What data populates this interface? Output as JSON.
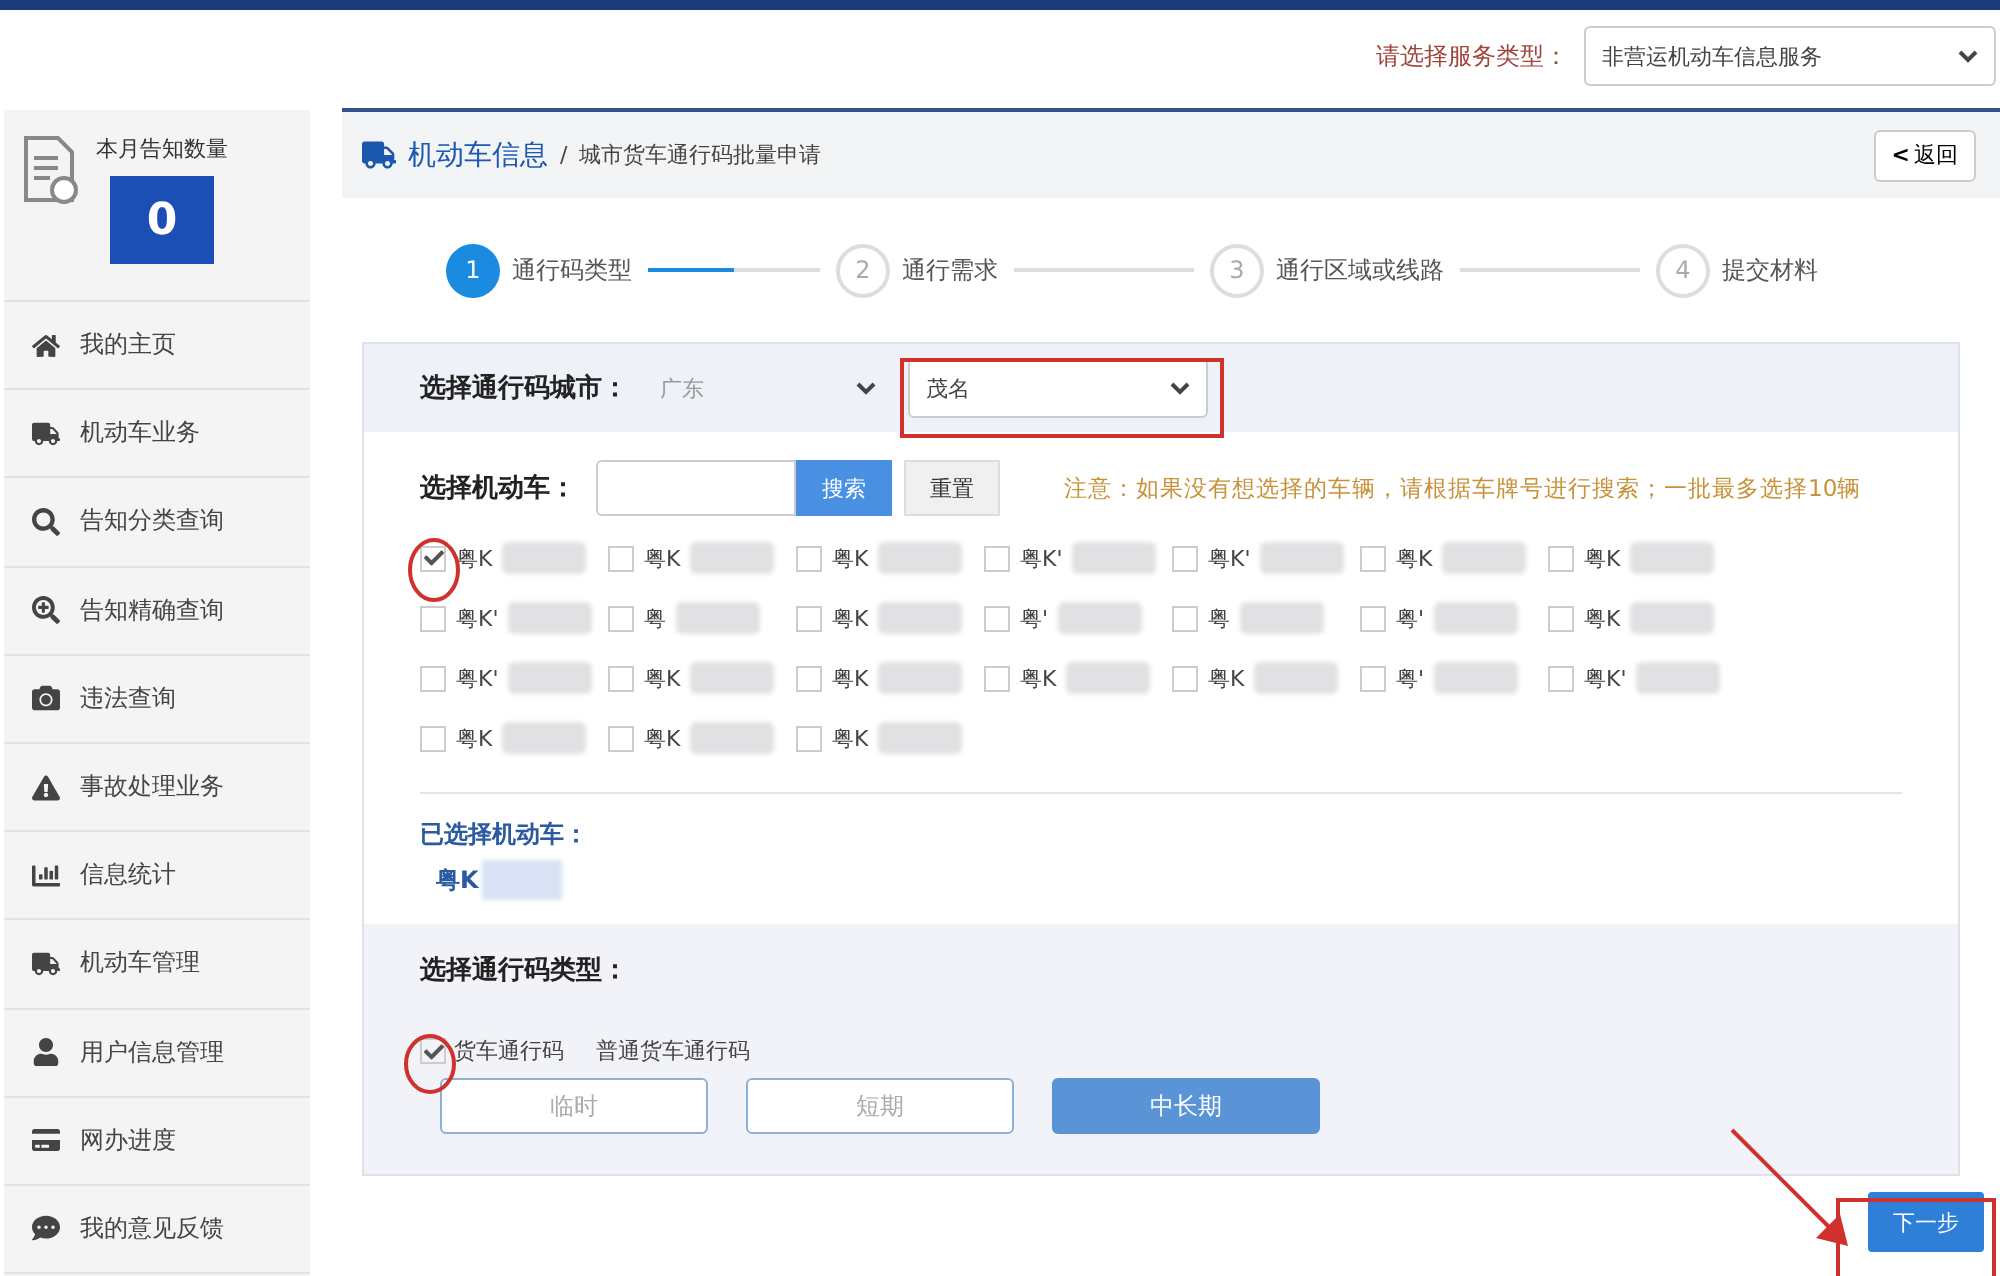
{
  "service": {
    "label": "请选择服务类型：",
    "value": "非营运机动车信息服务"
  },
  "sidebar": {
    "notice": {
      "label": "本月告知数量",
      "count": "0"
    },
    "items": [
      {
        "label": "我的主页",
        "kind": "home"
      },
      {
        "label": "机动车业务",
        "kind": "truck"
      },
      {
        "label": "告知分类查询",
        "kind": "search"
      },
      {
        "label": "告知精确查询",
        "kind": "zoom"
      },
      {
        "label": "违法查询",
        "kind": "camera"
      },
      {
        "label": "事故处理业务",
        "kind": "warning"
      },
      {
        "label": "信息统计",
        "kind": "chart"
      },
      {
        "label": "机动车管理",
        "kind": "truck"
      },
      {
        "label": "用户信息管理",
        "kind": "user"
      },
      {
        "label": "网办进度",
        "kind": "card"
      },
      {
        "label": "我的意见反馈",
        "kind": "feedback"
      }
    ]
  },
  "breadcrumb": {
    "section": "机动车信息",
    "separator": "/",
    "page": "城市货车通行码批量申请",
    "back": "返回",
    "back_icon": "<"
  },
  "steps": [
    {
      "number": "1",
      "label": "通行码类型",
      "selected": true
    },
    {
      "number": "2",
      "label": "通行需求",
      "selected": false
    },
    {
      "number": "3",
      "label": "通行区域或线路",
      "selected": false
    },
    {
      "number": "4",
      "label": "提交材料",
      "selected": false
    }
  ],
  "city": {
    "label": "选择通行码城市：",
    "province": "广东",
    "city": "茂名"
  },
  "vehicle": {
    "label": "选择机动车：",
    "search": "搜索",
    "reset": "重置",
    "notice": "注意：如果没有想选择的车辆，请根据车牌号进行搜索；一批最多选择10辆",
    "plates": [
      {
        "text": "粤K",
        "checked": true
      },
      {
        "text": "粤K",
        "checked": false
      },
      {
        "text": "粤K",
        "checked": false
      },
      {
        "text": "粤K'",
        "checked": false
      },
      {
        "text": "粤K'",
        "checked": false
      },
      {
        "text": "粤K",
        "checked": false
      },
      {
        "text": "粤K",
        "checked": false
      },
      {
        "text": "粤K'",
        "checked": false
      },
      {
        "text": "粤",
        "checked": false
      },
      {
        "text": "粤K",
        "checked": false
      },
      {
        "text": "粤'",
        "checked": false
      },
      {
        "text": "粤",
        "checked": false
      },
      {
        "text": "粤'",
        "checked": false
      },
      {
        "text": "粤K",
        "checked": false
      },
      {
        "text": "粤K'",
        "checked": false
      },
      {
        "text": "粤K",
        "checked": false
      },
      {
        "text": "粤K",
        "checked": false
      },
      {
        "text": "粤K",
        "checked": false
      },
      {
        "text": "粤K",
        "checked": false
      },
      {
        "text": "粤'",
        "checked": false
      },
      {
        "text": "粤K'",
        "checked": false
      },
      {
        "text": "粤K",
        "checked": false
      },
      {
        "text": "粤K",
        "checked": false
      },
      {
        "text": "粤K",
        "checked": false
      }
    ]
  },
  "selected_vehicles": {
    "label": "已选择机动车：",
    "items": [
      "粤K"
    ]
  },
  "pass_type": {
    "label": "选择通行码类型：",
    "option": {
      "label": "货车通行码",
      "checked": true
    },
    "hint": "普通货车通行码",
    "durations": [
      {
        "label": "临时",
        "selected": false
      },
      {
        "label": "短期",
        "selected": false
      },
      {
        "label": "中长期",
        "selected": true
      }
    ]
  },
  "next": "下一步"
}
